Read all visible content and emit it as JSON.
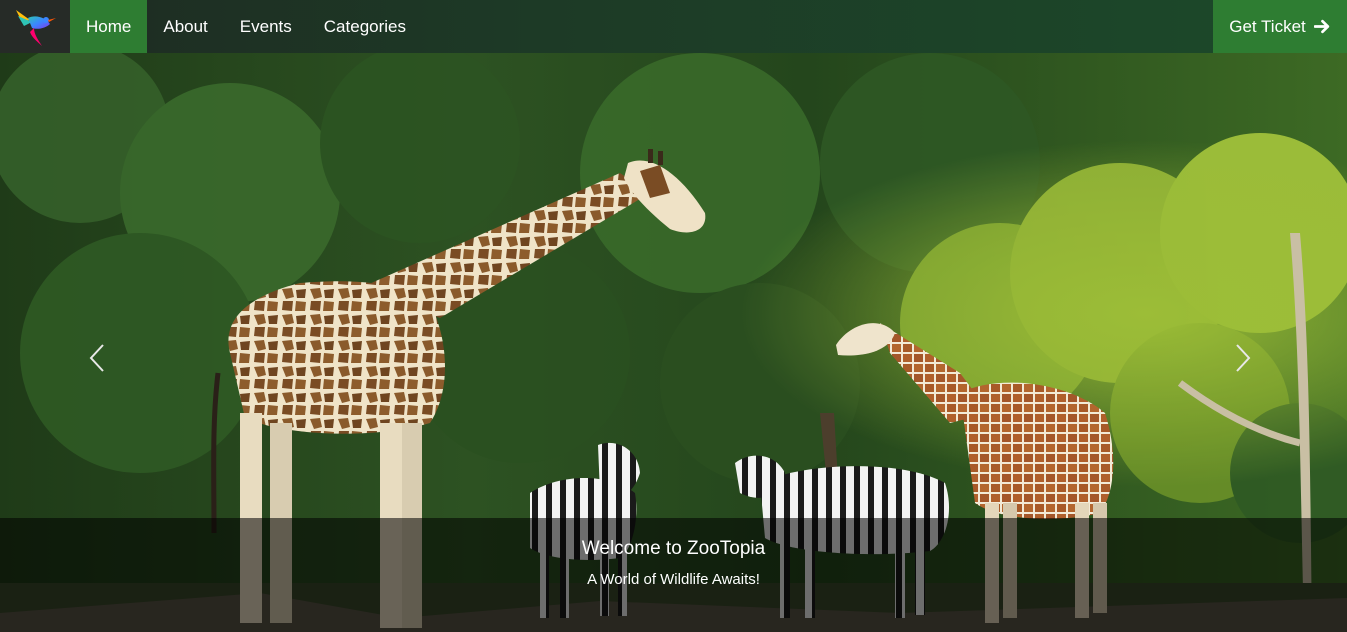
{
  "nav": {
    "links": [
      {
        "label": "Home",
        "active": true
      },
      {
        "label": "About",
        "active": false
      },
      {
        "label": "Events",
        "active": false
      },
      {
        "label": "Categories",
        "active": false
      }
    ],
    "cta_label": "Get Ticket",
    "cta_icon": "arrow-right-icon",
    "logo_icon": "hummingbird-logo-icon"
  },
  "hero": {
    "title": "Welcome to ZooTopia",
    "subtitle": "A World of Wildlife Awaits!",
    "prev_icon": "chevron-left-icon",
    "next_icon": "chevron-right-icon"
  },
  "colors": {
    "nav_active": "#2e7d32",
    "nav_bg": "#1d3a26",
    "logo_bg": "#262b27"
  }
}
